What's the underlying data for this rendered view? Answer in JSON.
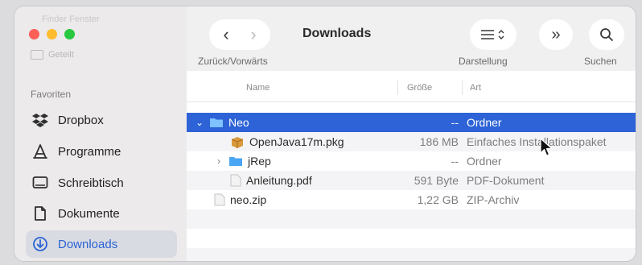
{
  "window": {
    "ghost_title": "Finder Fenster",
    "ghost_shared": "Geteilt",
    "traffic_lights": {
      "close": "#fe5f57",
      "minimize": "#febc2e",
      "zoom": "#28c840"
    }
  },
  "sidebar": {
    "section": "Favoriten",
    "items": [
      {
        "label": "Dropbox",
        "icon": "dropbox-icon"
      },
      {
        "label": "Programme",
        "icon": "applications-icon"
      },
      {
        "label": "Schreibtisch",
        "icon": "desktop-icon"
      },
      {
        "label": "Dokumente",
        "icon": "document-icon"
      },
      {
        "label": "Downloads",
        "icon": "downloads-icon",
        "active": true
      }
    ]
  },
  "toolbar": {
    "title": "Downloads",
    "nav_label": "Zurück/Vorwärts",
    "view_label": "Darstellung",
    "search_label": "Suchen"
  },
  "columns": {
    "name": "Name",
    "size": "Größe",
    "kind": "Art"
  },
  "files": [
    {
      "name": "Neo",
      "size": "--",
      "kind": "Ordner",
      "type": "folder",
      "expanded": true,
      "selected": true,
      "indent": 0
    },
    {
      "name": "OpenJava17m.pkg",
      "size": "186 MB",
      "kind": "Einfaches Installationspaket",
      "type": "package",
      "indent": 1
    },
    {
      "name": "jRep",
      "size": "--",
      "kind": "Ordner",
      "type": "folder",
      "expanded": false,
      "indent": 1
    },
    {
      "name": "Anleitung.pdf",
      "size": "591 Byte",
      "kind": "PDF-Dokument",
      "type": "file",
      "indent": 1
    },
    {
      "name": "neo.zip",
      "size": "1,22 GB",
      "kind": "ZIP-Archiv",
      "type": "file",
      "indent": 0
    }
  ],
  "colors": {
    "accent": "#2d63d6",
    "folder": "#3b9bee",
    "sidebar_active_text": "#2a62d4"
  }
}
